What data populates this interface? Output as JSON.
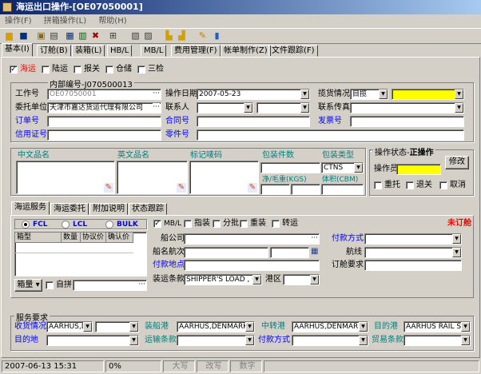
{
  "window": {
    "title": "海运出口操作-[OE07050001]"
  },
  "menu": [
    "操作(F)",
    "拼箱操作(L)",
    "帮助(H)"
  ],
  "tabs": [
    "基本(I)",
    "订舱(B)",
    "装箱(L)",
    "HB/L",
    "MB/L",
    "费用管理(F)",
    "帐单制作(Z)",
    "文件跟踪(F)"
  ],
  "transport": [
    {
      "label": "海运",
      "checked": true
    },
    {
      "label": "陆运",
      "checked": false
    },
    {
      "label": "报关",
      "checked": false
    },
    {
      "label": "仓储",
      "checked": false
    },
    {
      "label": "三检",
      "checked": false
    }
  ],
  "internal_no": "内部编号-J070500013",
  "form": {
    "work_no_label": "工作号",
    "work_no": "OE07050001",
    "op_date_label": "操作日期",
    "op_date": "2007-05-23",
    "goods_status_label": "揽货情况",
    "goods_status": "目揽",
    "client_label": "委托单位",
    "client": "天津市嘉达货运代理有限公司",
    "contact_label": "联系人",
    "contact_fax_label": "联系传真",
    "booking_no_label": "订单号",
    "contract_no_label": "合同号",
    "invoice_no_label": "发票号",
    "credit_no_label": "信用证号",
    "parts_no_label": "零件号"
  },
  "goods": {
    "cn_name": "中文品名",
    "en_name": "英文品名",
    "marks": "标记唛码",
    "pkg_count": "包装件数",
    "pkg_type": "包装类型",
    "pkg_type_value": "CTNS",
    "weight": "净/毛重(KGS)",
    "volume": "体积(CBM)"
  },
  "op_status": {
    "title": "操作状态",
    "state": "正操作",
    "operator_label": "操作员",
    "modify_btn": "修改",
    "options": [
      "重托",
      "退关",
      "取消"
    ]
  },
  "subtabs": [
    "海运服务",
    "海运委托",
    "附加说明",
    "状态跟踪"
  ],
  "container": {
    "modes": [
      {
        "label": "FCL",
        "on": true
      },
      {
        "label": "LCL",
        "on": false
      },
      {
        "label": "BULK",
        "on": false
      }
    ],
    "columns": [
      "箱型",
      "数量",
      "协议价",
      "确认价"
    ],
    "box_btn": "箱量",
    "self_pack": "自拼"
  },
  "shipping": {
    "bl_options": [
      {
        "label": "MB/L",
        "checked": true
      },
      {
        "label": "指装",
        "checked": false
      },
      {
        "label": "分批",
        "checked": false
      },
      {
        "label": "重装",
        "checked": false
      },
      {
        "label": "转运",
        "checked": false
      }
    ],
    "not_booked": "未订舱",
    "carrier_label": "船公司",
    "vessel_label": "船名航次",
    "pay_place_label": "付款地点",
    "terms_label": "装运条款",
    "terms": "SHIPPER'S LOAD , COU",
    "port_zone_label": "港区",
    "pay_method_label": "付款方式",
    "route_label": "航线",
    "booking_req_label": "订舱要求"
  },
  "service": {
    "title": "服务要求",
    "receipt_label": "收货情况",
    "receipt": "AARHUS,DE",
    "load_port_label": "装船港",
    "load_port": "AARHUS,DENMARK",
    "transit_port_label": "中转港",
    "transit_port": "AARHUS,DENMARK",
    "dest_port_label": "目的港",
    "dest_port": "AARHUS RAIL STA",
    "dest_label": "目的地",
    "freight_terms_label": "运输条款",
    "pay_method_label": "付款方式",
    "trade_terms_label": "贸易条款"
  },
  "status": {
    "datetime": "2007-06-13 15:31",
    "progress": "0%",
    "caps": "大写",
    "insert": "改写",
    "num": "数字"
  }
}
